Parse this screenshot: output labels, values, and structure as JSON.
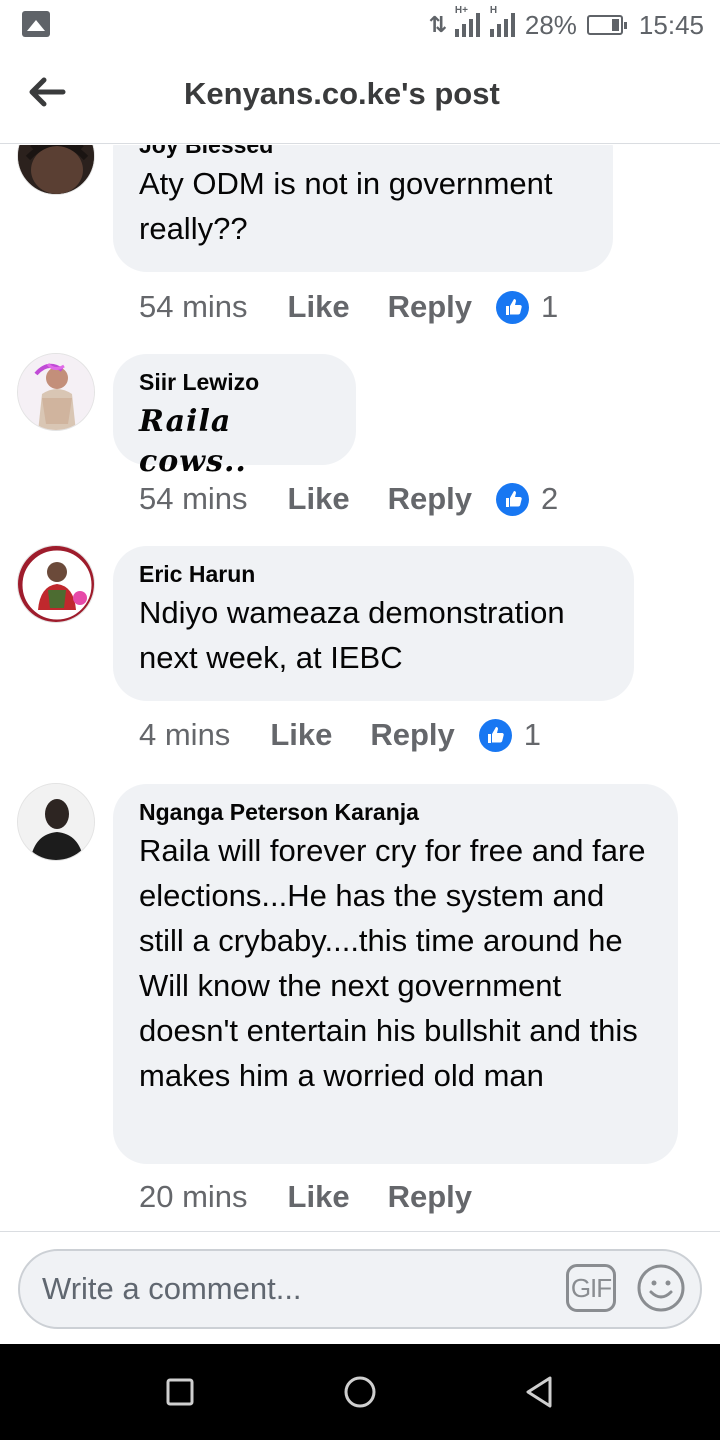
{
  "status_bar": {
    "network": "H+",
    "data_arrows": "⇅",
    "second_signal": "H",
    "battery": "28%",
    "time": "15:45"
  },
  "header": {
    "title": "Kenyans.co.ke's post",
    "back_icon": "arrow-left-icon"
  },
  "comments": [
    {
      "author": "Joy Blessed",
      "text": "Aty ODM is not in government really??",
      "time": "54 mins",
      "like_label": "Like",
      "reply_label": "Reply",
      "reactions": "1"
    },
    {
      "author": "Siir Lewizo",
      "text": "Raila cows..",
      "time": "54 mins",
      "like_label": "Like",
      "reply_label": "Reply",
      "reactions": "2"
    },
    {
      "author": "Eric Harun",
      "text": "Ndiyo wameaza demonstration next week, at IEBC",
      "time": "4 mins",
      "like_label": "Like",
      "reply_label": "Reply",
      "reactions": "1"
    },
    {
      "author": "Nganga Peterson Karanja",
      "text": "Raila will forever cry for free and fare elections...He has the system and still a crybaby....this time around he Will know the next government doesn't entertain his bullshit and this makes him a worried old man",
      "time": "20 mins",
      "like_label": "Like",
      "reply_label": "Reply"
    }
  ],
  "composer": {
    "placeholder": "Write a comment...",
    "gif_label": "GIF",
    "emoji_icon": "smiley-icon"
  },
  "colors": {
    "bubble": "#f0f2f5",
    "meta": "#65676b",
    "like_blue": "#1877f2"
  }
}
